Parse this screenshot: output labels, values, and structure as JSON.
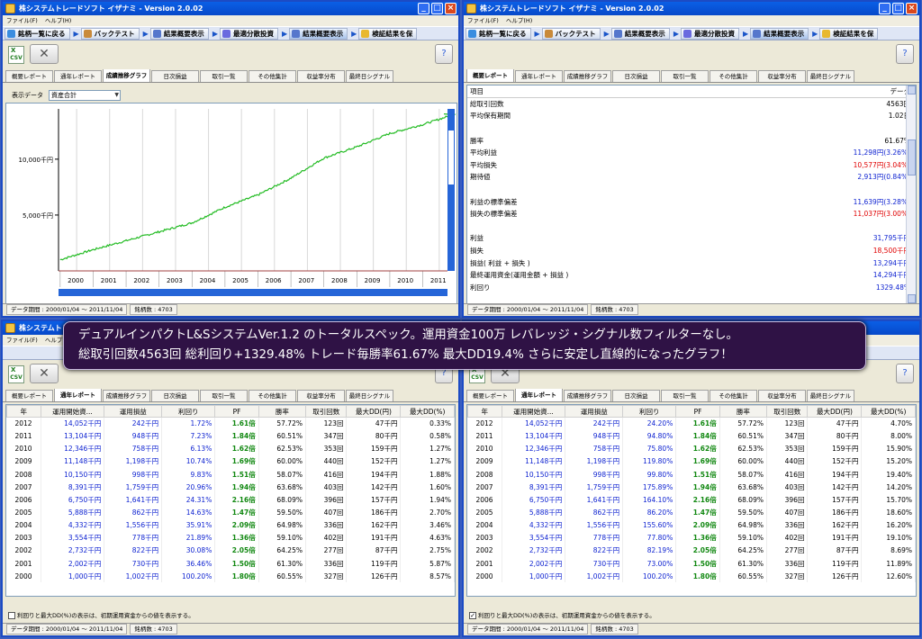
{
  "app_title": "株システムトレードソフト イザナミ - Version 2.0.02",
  "menu": [
    "ファイル(F)",
    "ヘルプ(H)"
  ],
  "nav_left": [
    "銘柄一覧に戻る",
    "バックテスト",
    "結果概要表示",
    "最適分散投資",
    "結果概要表示",
    "検証結果を保"
  ],
  "nav_right": [
    "銘柄一覧に戻る",
    "バックテスト",
    "結果概要表示",
    "最適分散投資",
    "結果概要表示",
    "検証結果を保"
  ],
  "csv_label": "CSV",
  "tabs": [
    "概要レポート",
    "通年レポート",
    "成績推移グラフ",
    "日次損益",
    "取引一覧",
    "その他集計",
    "収益率分布",
    "最終日シグナル"
  ],
  "status": {
    "period": "データ期間 : 2000/01/04 〜 2011/11/04",
    "stocks": "銘柄数 : 4703"
  },
  "chart_panel": {
    "select_label": "表示データ",
    "select_value": "資産合計",
    "ytick_labels": [
      "10,000千円",
      "5,000千円"
    ],
    "xtick_labels": [
      "2000",
      "2001",
      "2002",
      "2003",
      "2004",
      "2005",
      "2006",
      "2007",
      "2008",
      "2009",
      "2010",
      "2011"
    ]
  },
  "chart_data": {
    "type": "line",
    "title": "",
    "ylabel": "",
    "xlabel": "",
    "ylim": [
      0,
      14500
    ],
    "yticks": [
      5000,
      10000
    ],
    "x": [
      "2000",
      "2001",
      "2002",
      "2003",
      "2004",
      "2005",
      "2006",
      "2007",
      "2008",
      "2009",
      "2010",
      "2011",
      "2011/11"
    ],
    "series": [
      {
        "name": "資産合計",
        "color": "#22bb22",
        "values": [
          1000,
          1900,
          2700,
          3500,
          4300,
          5700,
          6800,
          8300,
          10100,
          11100,
          12300,
          13100,
          14052
        ]
      }
    ]
  },
  "stats": {
    "header_item": "項目",
    "header_data": "データ",
    "rows": [
      {
        "label": "総取引回数",
        "value": "4563回",
        "color": "black"
      },
      {
        "label": "平均保有期間",
        "value": "1.02日",
        "color": "black"
      },
      {
        "label": "",
        "value": "",
        "color": "black"
      },
      {
        "label": "勝率",
        "value": "61.67%",
        "color": "black"
      },
      {
        "label": "平均利益",
        "value": "11,298円(3.26%)",
        "color": "blue"
      },
      {
        "label": "平均損失",
        "value": "10,577円(3.04%)",
        "color": "red"
      },
      {
        "label": "期待値",
        "value": "2,913円(0.84%)",
        "color": "blue"
      },
      {
        "label": "",
        "value": "",
        "color": "black"
      },
      {
        "label": "利益の標準偏差",
        "value": "11,639円(3.28%)",
        "color": "blue"
      },
      {
        "label": "損失の標準偏差",
        "value": "11,037円(3.00%)",
        "color": "red"
      },
      {
        "label": "",
        "value": "",
        "color": "black"
      },
      {
        "label": "利益",
        "value": "31,795千円",
        "color": "blue"
      },
      {
        "label": "損失",
        "value": "18,500千円",
        "color": "red"
      },
      {
        "label": "損益( 利益 + 損失 )",
        "value": "13,294千円",
        "color": "blue"
      },
      {
        "label": "最終運用資金(運用金額 + 損益 )",
        "value": "14,294千円",
        "color": "blue"
      },
      {
        "label": "利回り",
        "value": "1329.48%",
        "color": "blue"
      }
    ]
  },
  "banner": {
    "line1": "デュアルインパクトL&SシステムVer.1.2 のトータルスペック。運用資金100万 レバレッジ・シグナル数フィルターなし。",
    "line2": "総取引回数4563回 総利回り+1329.48% トレード毎勝率61.67% 最大DD19.4% さらに安定し直線的になったグラフ！"
  },
  "yearly": {
    "headers": [
      "年",
      "運用開始資...",
      "運用損益",
      "利回り",
      "PF",
      "勝率",
      "取引回数",
      "最大DD(円)",
      "最大DD(%)"
    ],
    "left_rows": [
      [
        "2012",
        "14,052千円",
        "242千円",
        "1.72%",
        "1.61倍",
        "57.72%",
        "123回",
        "47千円",
        "0.33%"
      ],
      [
        "2011",
        "13,104千円",
        "948千円",
        "7.23%",
        "1.84倍",
        "60.51%",
        "347回",
        "80千円",
        "0.58%"
      ],
      [
        "2010",
        "12,346千円",
        "758千円",
        "6.13%",
        "1.62倍",
        "62.53%",
        "353回",
        "159千円",
        "1.27%"
      ],
      [
        "2009",
        "11,148千円",
        "1,198千円",
        "10.74%",
        "1.69倍",
        "60.00%",
        "440回",
        "152千円",
        "1.27%"
      ],
      [
        "2008",
        "10,150千円",
        "998千円",
        "9.83%",
        "1.51倍",
        "58.07%",
        "416回",
        "194千円",
        "1.88%"
      ],
      [
        "2007",
        "8,391千円",
        "1,759千円",
        "20.96%",
        "1.94倍",
        "63.68%",
        "403回",
        "142千円",
        "1.60%"
      ],
      [
        "2006",
        "6,750千円",
        "1,641千円",
        "24.31%",
        "2.16倍",
        "68.09%",
        "396回",
        "157千円",
        "1.94%"
      ],
      [
        "2005",
        "5,888千円",
        "862千円",
        "14.63%",
        "1.47倍",
        "59.50%",
        "407回",
        "186千円",
        "2.70%"
      ],
      [
        "2004",
        "4,332千円",
        "1,556千円",
        "35.91%",
        "2.09倍",
        "64.98%",
        "336回",
        "162千円",
        "3.46%"
      ],
      [
        "2003",
        "3,554千円",
        "778千円",
        "21.89%",
        "1.36倍",
        "59.10%",
        "402回",
        "191千円",
        "4.63%"
      ],
      [
        "2002",
        "2,732千円",
        "822千円",
        "30.08%",
        "2.05倍",
        "64.25%",
        "277回",
        "87千円",
        "2.75%"
      ],
      [
        "2001",
        "2,002千円",
        "730千円",
        "36.46%",
        "1.50倍",
        "61.30%",
        "336回",
        "119千円",
        "5.87%"
      ],
      [
        "2000",
        "1,000千円",
        "1,002千円",
        "100.20%",
        "1.80倍",
        "60.55%",
        "327回",
        "126千円",
        "8.57%"
      ]
    ],
    "right_rows": [
      [
        "2012",
        "14,052千円",
        "242千円",
        "24.20%",
        "1.61倍",
        "57.72%",
        "123回",
        "47千円",
        "4.70%"
      ],
      [
        "2011",
        "13,104千円",
        "948千円",
        "94.80%",
        "1.84倍",
        "60.51%",
        "347回",
        "80千円",
        "8.00%"
      ],
      [
        "2010",
        "12,346千円",
        "758千円",
        "75.80%",
        "1.62倍",
        "62.53%",
        "353回",
        "159千円",
        "15.90%"
      ],
      [
        "2009",
        "11,148千円",
        "1,198千円",
        "119.80%",
        "1.69倍",
        "60.00%",
        "440回",
        "152千円",
        "15.20%"
      ],
      [
        "2008",
        "10,150千円",
        "998千円",
        "99.80%",
        "1.51倍",
        "58.07%",
        "416回",
        "194千円",
        "19.40%"
      ],
      [
        "2007",
        "8,391千円",
        "1,759千円",
        "175.89%",
        "1.94倍",
        "63.68%",
        "403回",
        "142千円",
        "14.20%"
      ],
      [
        "2006",
        "6,750千円",
        "1,641千円",
        "164.10%",
        "2.16倍",
        "68.09%",
        "396回",
        "157千円",
        "15.70%"
      ],
      [
        "2005",
        "5,888千円",
        "862千円",
        "86.20%",
        "1.47倍",
        "59.50%",
        "407回",
        "186千円",
        "18.60%"
      ],
      [
        "2004",
        "4,332千円",
        "1,556千円",
        "155.60%",
        "2.09倍",
        "64.98%",
        "336回",
        "162千円",
        "16.20%"
      ],
      [
        "2003",
        "3,554千円",
        "778千円",
        "77.80%",
        "1.36倍",
        "59.10%",
        "402回",
        "191千円",
        "19.10%"
      ],
      [
        "2002",
        "2,732千円",
        "822千円",
        "82.19%",
        "2.05倍",
        "64.25%",
        "277回",
        "87千円",
        "8.69%"
      ],
      [
        "2001",
        "2,002千円",
        "730千円",
        "73.00%",
        "1.50倍",
        "61.30%",
        "336回",
        "119千円",
        "11.89%"
      ],
      [
        "2000",
        "1,000千円",
        "1,002千円",
        "100.20%",
        "1.80倍",
        "60.55%",
        "327回",
        "126千円",
        "12.60%"
      ]
    ],
    "checkbox_label": "利回りと最大DD(%)の表示は、初期運用資金からの値を表示する。",
    "left_checked": false,
    "right_checked": true
  }
}
